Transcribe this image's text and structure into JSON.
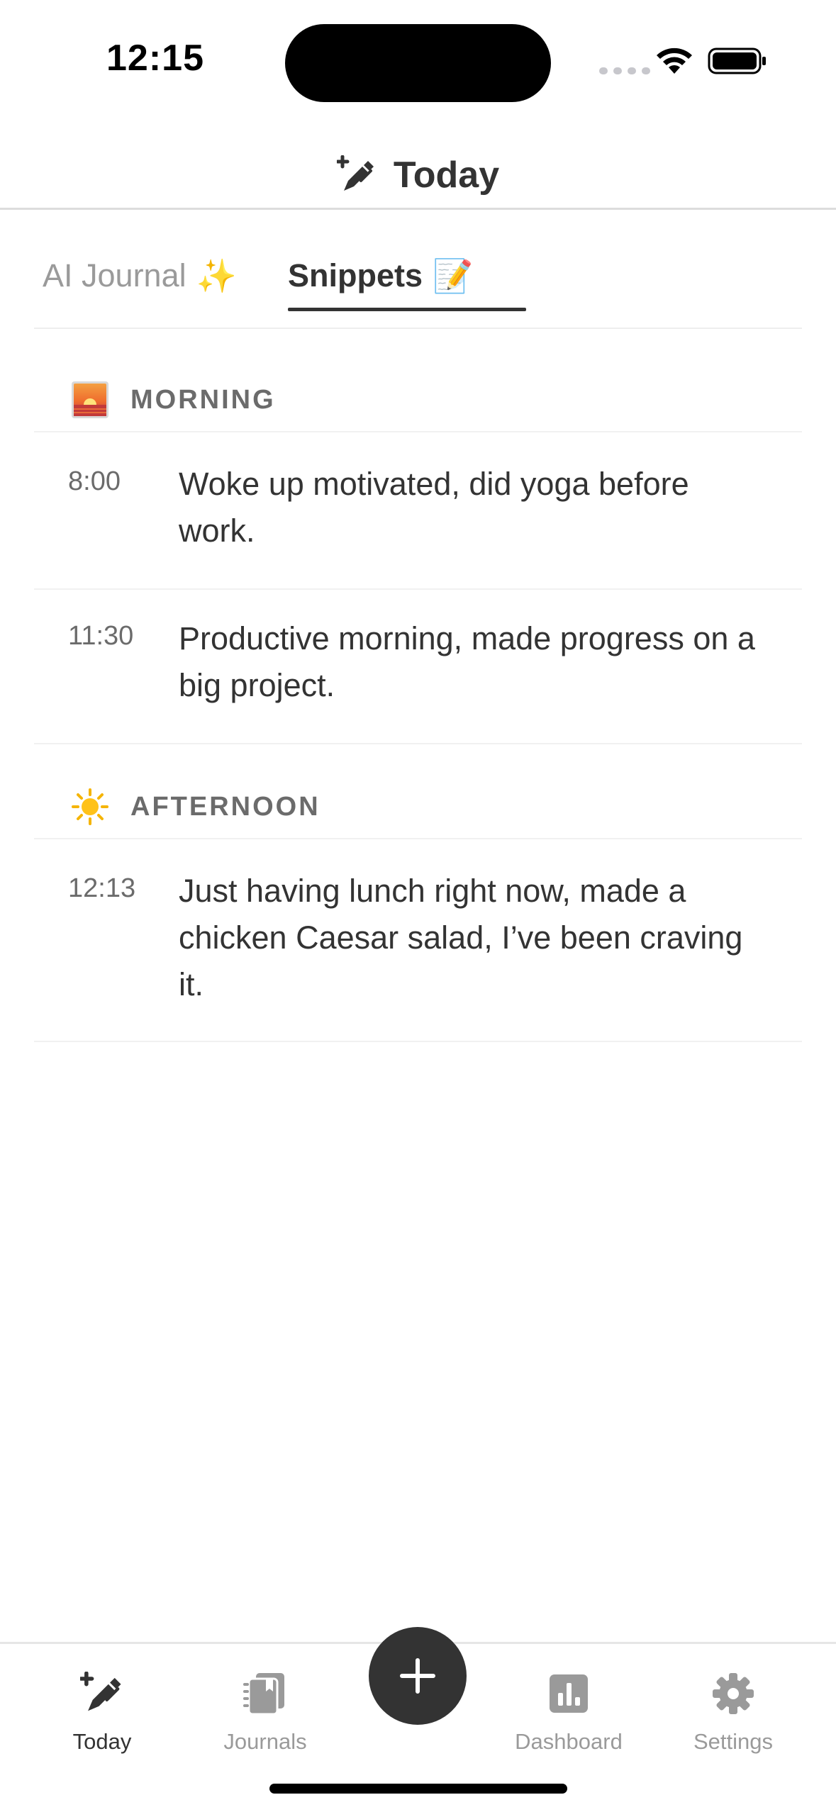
{
  "status_bar": {
    "time": "12:15"
  },
  "header": {
    "title": "Today",
    "icon": "wand-pen-icon"
  },
  "tabs": [
    {
      "label": "AI Journal",
      "emoji": "✨",
      "active": false
    },
    {
      "label": "Snippets",
      "emoji": "📝",
      "active": true
    }
  ],
  "sections": [
    {
      "title": "MORNING",
      "icon": "sunrise-icon",
      "entries": [
        {
          "time": "8:00",
          "text": "Woke up motivated, did yoga before work."
        },
        {
          "time": "11:30",
          "text": "Productive morning, made progress on a big project."
        }
      ]
    },
    {
      "title": "AFTERNOON",
      "icon": "sun-icon",
      "entries": [
        {
          "time": "12:13",
          "text": "Just having lunch right now, made a chicken Caesar salad, I’ve been craving it."
        }
      ]
    }
  ],
  "nav": [
    {
      "label": "Today",
      "icon": "wand-pen-icon",
      "active": true
    },
    {
      "label": "Journals",
      "icon": "journals-icon",
      "active": false
    },
    {
      "label": "Dashboard",
      "icon": "chart-icon",
      "active": false
    },
    {
      "label": "Settings",
      "icon": "gear-icon",
      "active": false
    }
  ],
  "add_button": {
    "icon": "plus-icon"
  }
}
